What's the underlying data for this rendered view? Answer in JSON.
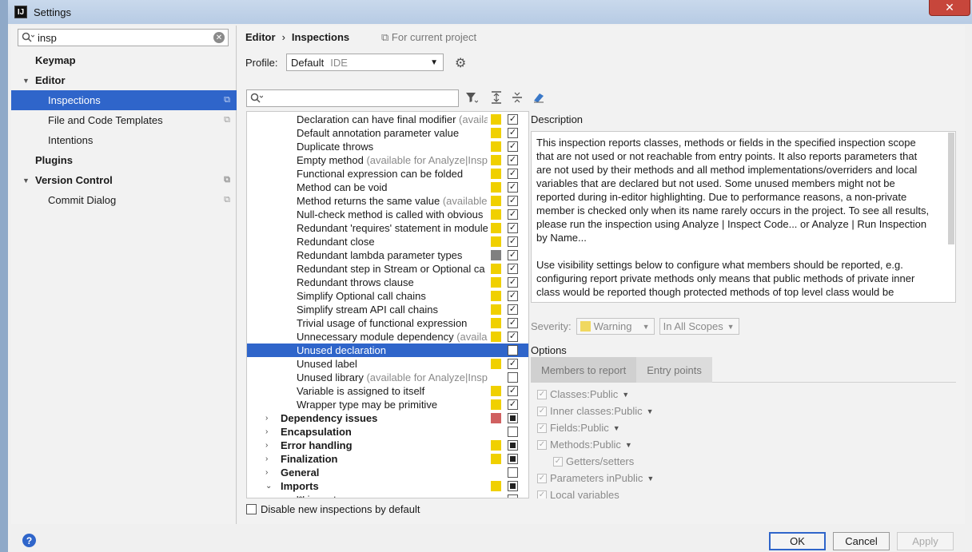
{
  "window": {
    "title": "Settings",
    "app_icon": "IJ",
    "close_glyph": "✕"
  },
  "sidebar": {
    "search_value": "insp",
    "items": [
      {
        "label": "Keymap"
      },
      {
        "label": "Editor"
      },
      {
        "label": "Inspections"
      },
      {
        "label": "File and Code Templates"
      },
      {
        "label": "Intentions"
      },
      {
        "label": "Plugins"
      },
      {
        "label": "Version Control"
      },
      {
        "label": "Commit Dialog"
      }
    ]
  },
  "header": {
    "breadcrumb": [
      "Editor",
      "Inspections"
    ],
    "breadcrumb_sep": "›",
    "for_project": "For current project",
    "profile_label": "Profile:",
    "profile_value": "Default",
    "profile_scope": "IDE"
  },
  "tree": {
    "rows": [
      {
        "label": "Declaration can have final modifier",
        "hint": " (availa",
        "color": "#f0d000",
        "check": "✓"
      },
      {
        "label": "Default annotation parameter value",
        "hint": "",
        "color": "#f0d000",
        "check": "✓"
      },
      {
        "label": "Duplicate throws",
        "hint": "",
        "color": "#f0d000",
        "check": "✓"
      },
      {
        "label": "Empty method",
        "hint": " (available for Analyze|Insp",
        "color": "#f0d000",
        "check": "✓"
      },
      {
        "label": "Functional expression can be folded",
        "hint": "",
        "color": "#f0d000",
        "check": "✓"
      },
      {
        "label": "Method can be void",
        "hint": "",
        "color": "#f0d000",
        "check": "✓"
      },
      {
        "label": "Method returns the same value",
        "hint": " (available",
        "color": "#f0d000",
        "check": "✓"
      },
      {
        "label": "Null-check method is called with obvious",
        "hint": "",
        "color": "#f0d000",
        "check": "✓"
      },
      {
        "label": "Redundant 'requires' statement in module",
        "hint": "",
        "color": "#f0d000",
        "check": "✓"
      },
      {
        "label": "Redundant close",
        "hint": "",
        "color": "#f0d000",
        "check": "✓"
      },
      {
        "label": "Redundant lambda parameter types",
        "hint": "",
        "color": "#808080",
        "check": "✓"
      },
      {
        "label": "Redundant step in Stream or Optional ca",
        "hint": "",
        "color": "#f0d000",
        "check": "✓"
      },
      {
        "label": "Redundant throws clause",
        "hint": "",
        "color": "#f0d000",
        "check": "✓"
      },
      {
        "label": "Simplify Optional call chains",
        "hint": "",
        "color": "#f0d000",
        "check": "✓"
      },
      {
        "label": "Simplify stream API call chains",
        "hint": "",
        "color": "#f0d000",
        "check": "✓"
      },
      {
        "label": "Trivial usage of functional expression",
        "hint": "",
        "color": "#f0d000",
        "check": "✓"
      },
      {
        "label": "Unnecessary module dependency",
        "hint": " (availal",
        "color": "#f0d000",
        "check": "✓"
      },
      {
        "label": "Unused declaration",
        "hint": "",
        "color": "",
        "check": ""
      },
      {
        "label": "Unused label",
        "hint": "",
        "color": "#f0d000",
        "check": "✓"
      },
      {
        "label": "Unused library",
        "hint": " (available for Analyze|Insp",
        "color": "",
        "check": ""
      },
      {
        "label": "Variable is assigned to itself",
        "hint": "",
        "color": "#f0d000",
        "check": "✓"
      },
      {
        "label": "Wrapper type may be primitive",
        "hint": "",
        "color": "#f0d000",
        "check": "✓"
      }
    ],
    "groups": [
      {
        "label": "Dependency issues",
        "color": "#d06060",
        "state": "partial",
        "expander": "›"
      },
      {
        "label": "Encapsulation",
        "color": "",
        "state": "none",
        "expander": "›"
      },
      {
        "label": "Error handling",
        "color": "#f0d000",
        "state": "partial",
        "expander": "›"
      },
      {
        "label": "Finalization",
        "color": "#f0d000",
        "state": "partial",
        "expander": "›"
      },
      {
        "label": "General",
        "color": "",
        "state": "none",
        "expander": "›"
      },
      {
        "label": "Imports",
        "color": "#f0d000",
        "state": "partial",
        "expander": "⌄"
      }
    ],
    "last_row": "'*' import",
    "disable_label": "Disable new inspections by default"
  },
  "description": {
    "label": "Description",
    "paragraphs": [
      "This inspection reports classes, methods or fields in the specified inspection scope that are not used or not reachable from entry points. It also reports parameters that are not used by their methods and all method implementations/overriders and local variables that are declared but not used. Some unused members might not be reported during in-editor highlighting. Due to performance reasons, a non-private member is checked only when its name rarely occurs in the project. To see all results, please run the inspection using Analyze | Inspect Code... or Analyze | Run Inspection by Name...",
      "Use visibility settings below to configure what members should be reported, e.g. configuring report private methods only means that public methods of private inner class would be reported though protected methods of top level class would be"
    ]
  },
  "severity": {
    "label": "Severity:",
    "value": "Warning",
    "scope": "In All Scopes",
    "swatch": "#f0d860"
  },
  "options": {
    "label": "Options",
    "tabs": [
      "Members to report",
      "Entry points"
    ],
    "items": [
      {
        "label": "Classes:",
        "value": "Public",
        "indent": 0
      },
      {
        "label": "Inner classes:",
        "value": "Public",
        "indent": 0
      },
      {
        "label": "Fields:",
        "value": "Public",
        "indent": 0
      },
      {
        "label": "Methods:",
        "value": "Public",
        "indent": 0
      },
      {
        "label": "Getters/setters",
        "value": "",
        "indent": 1
      },
      {
        "label": "Parameters in",
        "value": "Public",
        "indent": 0
      },
      {
        "label": "Local variables",
        "value": "",
        "indent": 0
      }
    ]
  },
  "buttons": {
    "ok": "OK",
    "cancel": "Cancel",
    "apply": "Apply",
    "help": "?"
  }
}
